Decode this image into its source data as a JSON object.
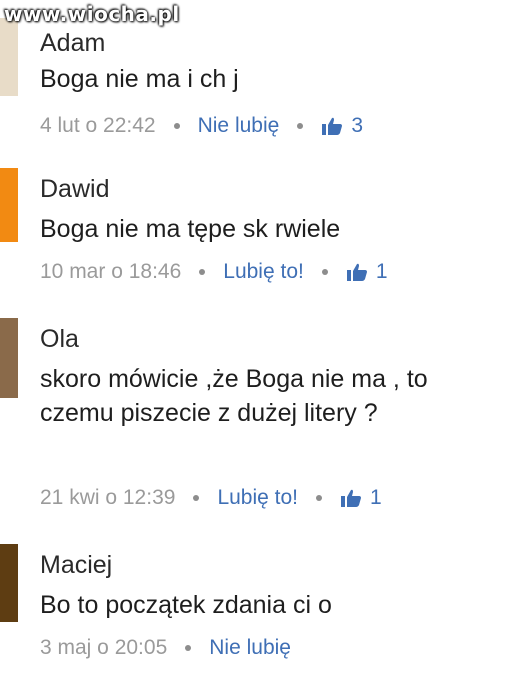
{
  "watermark": "www.wiocha.pl",
  "comments": [
    {
      "author": "Adam",
      "text": "Boga nie ma i ch  j",
      "date": "4 lut o 22:42",
      "action": "Nie lubię",
      "likes": "3",
      "bar_color": "#e8dcc8"
    },
    {
      "author": "Dawid",
      "text": "Boga nie ma tępe sk  rwiele",
      "date": "10 mar o 18:46",
      "action": "Lubię to!",
      "likes": "1",
      "bar_color": "#f28a12"
    },
    {
      "author": "Ola",
      "text": "skoro mówicie ,że Boga nie ma , to czemu piszecie z dużej litery ?",
      "date": "21 kwi o 12:39",
      "action": "Lubię to!",
      "likes": "1",
      "bar_color": "#8a6a4a"
    },
    {
      "author": "Maciej",
      "text": "Bo to początek zdania ci  o",
      "date": "3 maj o 20:05",
      "action": "Nie lubię",
      "likes": "",
      "bar_color": "#5e3d12"
    }
  ]
}
